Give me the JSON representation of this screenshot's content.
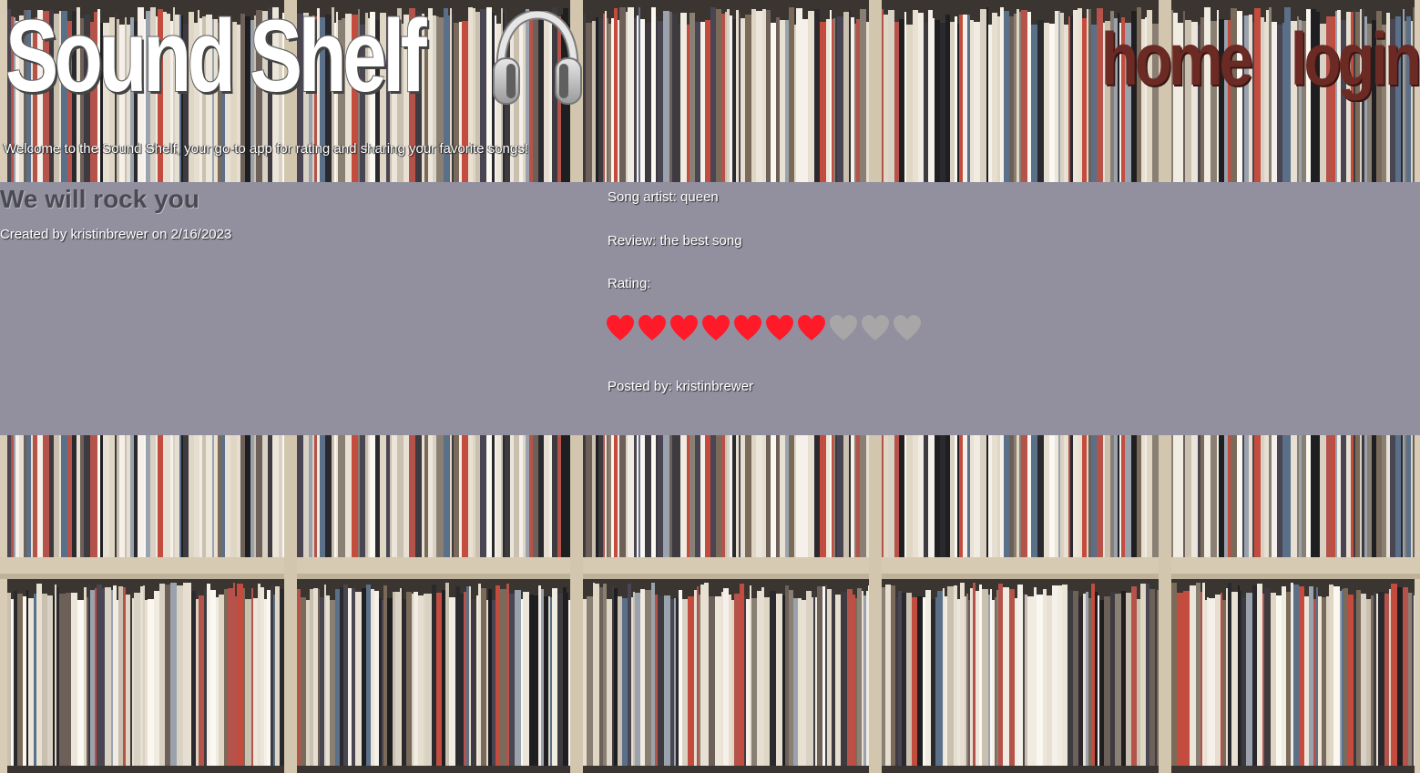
{
  "header": {
    "site_title": "Sound Shelf",
    "logo_icon": "headphones-icon",
    "nav": [
      {
        "label": "home"
      },
      {
        "label": "login"
      }
    ],
    "tagline": "Welcome to the Sound Shelf, your go-to app for rating and sharing your favorite songs!"
  },
  "review": {
    "song_title": "We will rock you",
    "created_line": "Created by kristinbrewer on 2/16/2023",
    "artist_line": "Song artist: queen",
    "review_line": "Review: the best song",
    "rating_label": "Rating:",
    "rating": {
      "value": 7,
      "max": 10,
      "filled_color": "#ff1a2a",
      "empty_color": "#a8a6a6",
      "icon": "heart-icon"
    },
    "posted_by_line": "Posted by: kristinbrewer"
  },
  "colors": {
    "panel_background": "#92909f",
    "nav_text": "#6b2a24",
    "title_text": "#ffffff"
  }
}
